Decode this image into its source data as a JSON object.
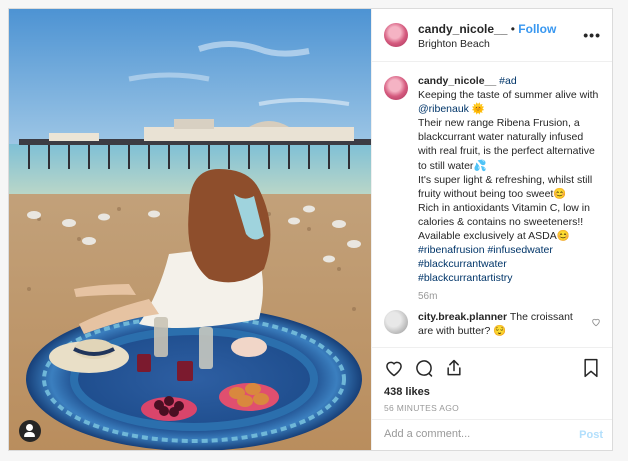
{
  "post": {
    "username": "candy_nicole__",
    "separator": "•",
    "follow_label": "Follow",
    "location": "Brighton Beach",
    "more_label": "•••",
    "caption": {
      "username": "candy_nicole__",
      "ad_tag": "#ad",
      "line1": "Keeping the taste of summer alive with",
      "mention": "@ribenauk",
      "emoji_sun": "🌞",
      "line2": "Their new range Ribena Frusion, a blackcurrant water naturally infused with real fruit, is the perfect alternative to still water",
      "emoji_drops": "💦",
      "line3": "It's super light & refreshing, whilst still fruity without being too sweet",
      "emoji_smile": "😊",
      "line4": "Rich in antioxidants Vitamin C, low in calories & contains no sweeteners!! Available exclusively at ASDA",
      "emoji_smile2": "😊",
      "hashtags": [
        "#ribenafrusion",
        "#infusedwater",
        "#blackcurrantwater",
        "#blackcurrantartistry"
      ]
    },
    "caption_time": "56m",
    "comment": {
      "username": "city.break.planner",
      "text": "The croissant are with butter?",
      "emoji": "😌"
    },
    "likes": "438 likes",
    "posted_time": "56 MINUTES AGO",
    "add_comment_placeholder": "Add a comment...",
    "post_label": "Post"
  },
  "icons": {
    "like": "heart-outline-icon",
    "comment": "comment-bubble-icon",
    "share": "share-arrow-icon",
    "save": "bookmark-icon",
    "tag": "user-tag-icon",
    "comment_like": "small-heart-icon"
  },
  "colors": {
    "follow": "#3897f0",
    "link": "#003569",
    "muted": "#999999",
    "post_disabled": "#b2dffc"
  }
}
